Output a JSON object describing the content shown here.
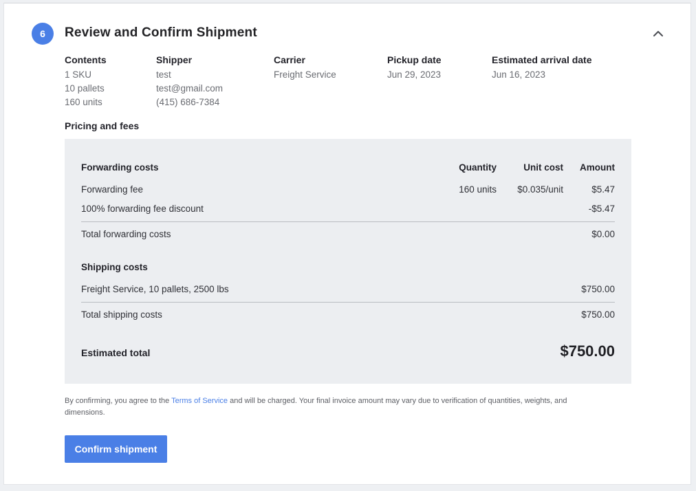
{
  "section": {
    "step_number": "6",
    "title": "Review and Confirm Shipment"
  },
  "summary": {
    "contents": {
      "label": "Contents",
      "lines": [
        "1 SKU",
        "10 pallets",
        "160 units"
      ]
    },
    "shipper": {
      "label": "Shipper",
      "lines": [
        "test",
        "test@gmail.com",
        "(415) 686-7384"
      ]
    },
    "carrier": {
      "label": "Carrier",
      "lines": [
        "Freight Service"
      ]
    },
    "pickup": {
      "label": "Pickup date",
      "lines": [
        "Jun 29, 2023"
      ]
    },
    "arrival": {
      "label": "Estimated arrival date",
      "lines": [
        "Jun 16, 2023"
      ]
    }
  },
  "pricing": {
    "title": "Pricing and fees",
    "forwarding": {
      "heading": "Forwarding costs",
      "col_quantity": "Quantity",
      "col_unit_cost": "Unit cost",
      "col_amount": "Amount",
      "items": [
        {
          "name": "Forwarding fee",
          "quantity": "160 units",
          "unit_cost": "$0.035/unit",
          "amount": "$5.47"
        },
        {
          "name": "100% forwarding fee discount",
          "quantity": "",
          "unit_cost": "",
          "amount": "-$5.47"
        }
      ],
      "total_label": "Total forwarding costs",
      "total_amount": "$0.00"
    },
    "shipping": {
      "heading": "Shipping costs",
      "items": [
        {
          "name": "Freight Service, 10 pallets, 2500 lbs",
          "amount": "$750.00"
        }
      ],
      "total_label": "Total shipping costs",
      "total_amount": "$750.00"
    },
    "estimated_total_label": "Estimated total",
    "estimated_total_amount": "$750.00"
  },
  "disclaimer": {
    "prefix": "By confirming, you agree to the ",
    "link": "Terms of Service",
    "suffix": " and will be charged. Your final invoice amount may vary due to verification of quantities, weights, and dimensions."
  },
  "confirm_button": "Confirm shipment",
  "colors": {
    "accent": "#4a7fe6",
    "panel": "#eceef1"
  },
  "icons": {
    "collapse": "chevron-up-icon"
  }
}
